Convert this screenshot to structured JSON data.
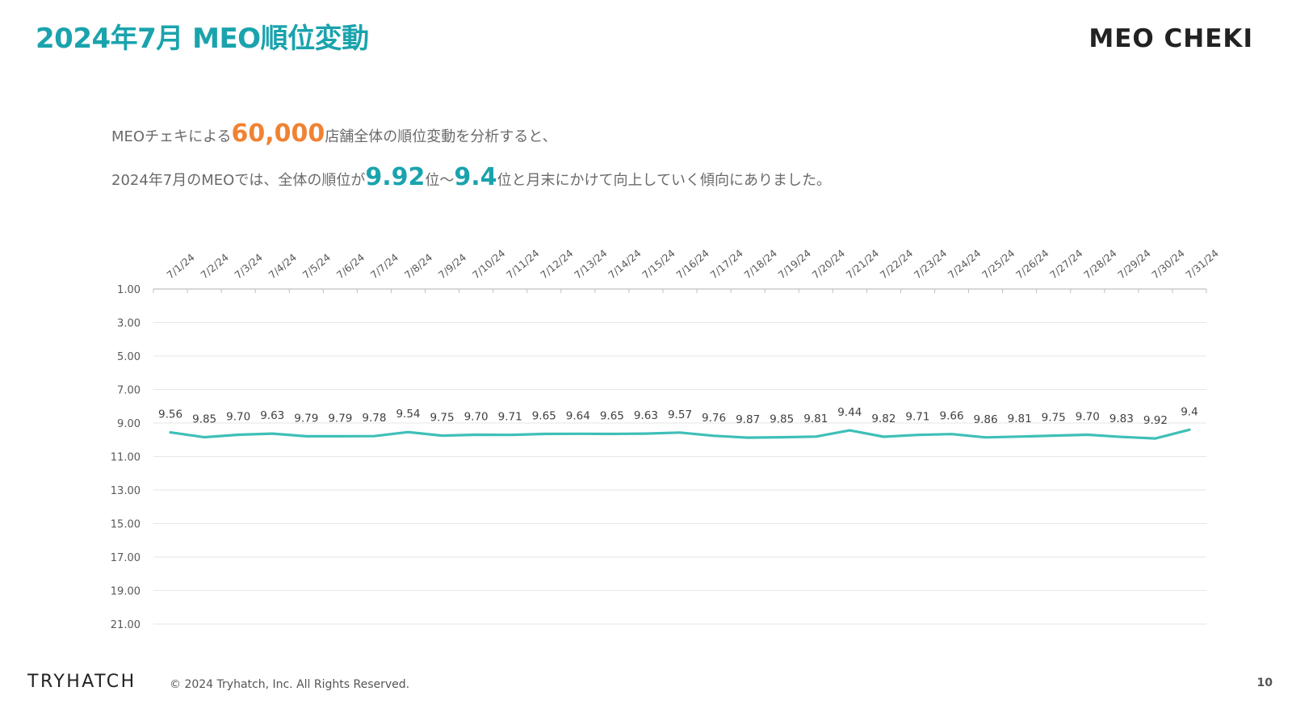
{
  "page": {
    "title": "2024年7月 MEO順位変動",
    "brand": "MEO CHEKI",
    "page_number": "10"
  },
  "summary": {
    "line1_prefix": "MEOチェキによる",
    "line1_number": "60,000",
    "line1_suffix": "店舗全体の順位変動を分析すると、",
    "line2_prefix": "2024年7月のMEOでは、全体の順位が",
    "line2_value1": "9.92",
    "line2_mid": "位〜",
    "line2_value2": "9.4",
    "line2_suffix": "位と月末にかけて向上していく傾向にありました。"
  },
  "footer": {
    "company": "TRYHATCH",
    "copyright": "© 2024 Tryhatch, Inc. All Rights Reserved."
  },
  "colors": {
    "title": "#1aa3ad",
    "line": "#3fbfb8",
    "highlight_orange": "#f08232",
    "highlight_teal": "#1aa3ad"
  },
  "chart_data": {
    "type": "line",
    "title": "",
    "xlabel": "",
    "ylabel": "",
    "y_axis_inverted": true,
    "ylim": [
      1,
      21
    ],
    "y_ticks": [
      "1.00",
      "3.00",
      "5.00",
      "7.00",
      "9.00",
      "11.00",
      "13.00",
      "15.00",
      "17.00",
      "19.00",
      "21.00"
    ],
    "x_axis_position": "top",
    "grid": true,
    "legend": "none",
    "categories": [
      "7/1/24",
      "7/2/24",
      "7/3/24",
      "7/4/24",
      "7/5/24",
      "7/6/24",
      "7/7/24",
      "7/8/24",
      "7/9/24",
      "7/10/24",
      "7/11/24",
      "7/12/24",
      "7/13/24",
      "7/14/24",
      "7/15/24",
      "7/16/24",
      "7/17/24",
      "7/18/24",
      "7/19/24",
      "7/20/24",
      "7/21/24",
      "7/22/24",
      "7/23/24",
      "7/24/24",
      "7/25/24",
      "7/26/24",
      "7/27/24",
      "7/28/24",
      "7/29/24",
      "7/30/24",
      "7/31/24"
    ],
    "series": [
      {
        "values": [
          9.56,
          9.85,
          9.7,
          9.63,
          9.79,
          9.79,
          9.78,
          9.54,
          9.75,
          9.7,
          9.71,
          9.65,
          9.64,
          9.65,
          9.63,
          9.57,
          9.76,
          9.87,
          9.85,
          9.81,
          9.44,
          9.82,
          9.71,
          9.66,
          9.86,
          9.81,
          9.75,
          9.7,
          9.83,
          9.92,
          9.4
        ],
        "labels": [
          "9.56",
          "9.85",
          "9.70",
          "9.63",
          "9.79",
          "9.79",
          "9.78",
          "9.54",
          "9.75",
          "9.70",
          "9.71",
          "9.65",
          "9.64",
          "9.65",
          "9.63",
          "9.57",
          "9.76",
          "9.87",
          "9.85",
          "9.81",
          "9.44",
          "9.82",
          "9.71",
          "9.66",
          "9.86",
          "9.81",
          "9.75",
          "9.70",
          "9.83",
          "9.92",
          "9.4"
        ]
      }
    ]
  }
}
